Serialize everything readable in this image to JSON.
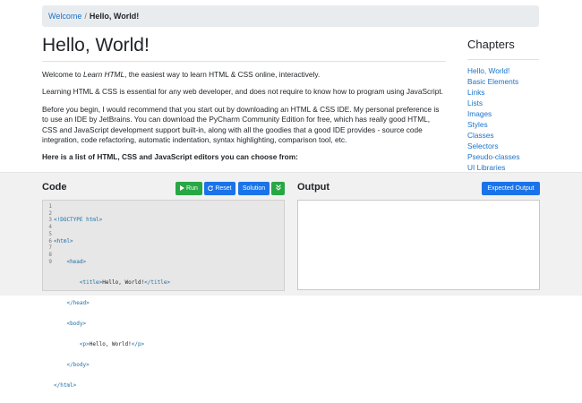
{
  "breadcrumb": {
    "home": "Welcome",
    "separator": "/",
    "current": "Hello, World!"
  },
  "page_title": "Hello, World!",
  "content": {
    "p1_prefix": "Welcome to ",
    "p1_em": "Learn HTML",
    "p1_suffix": ", the easiest way to learn HTML & CSS online, interactively.",
    "p2": "Learning HTML & CSS is essential for any web developer, and does not require to know how to program using JavaScript.",
    "p3": "Before you begin, I would recommend that you start out by downloading an HTML & CSS IDE. My personal preference is to use an IDE by JetBrains. You can download the PyCharm Community Edition for free, which has really good HTML, CSS and JavaScript development support built-in, along with all the goodies that a good IDE provides - source code integration, code refactoring, automatic indentation, syntax highlighting, comparison tool, etc.",
    "p4": "Here is a list of HTML, CSS and JavaScript editors you can choose from:"
  },
  "chapters": {
    "title": "Chapters",
    "items": [
      "Hello, World!",
      "Basic Elements",
      "Links",
      "Lists",
      "Images",
      "Styles",
      "Classes",
      "Selectors",
      "Pseudo-classes",
      "UI Libraries"
    ]
  },
  "code_pane": {
    "title": "Code",
    "run_label": "Run",
    "reset_label": "Reset",
    "solution_label": "Solution",
    "line_numbers": [
      "1",
      "2",
      "3",
      "4",
      "5",
      "6",
      "7",
      "8",
      "9"
    ],
    "lines": [
      "<!DOCTYPE html>",
      "<html>",
      "    <head>",
      "        <title>Hello, World!</title>",
      "    </head>",
      "    <body>",
      "        <p>Hello, World!</p>",
      "    </body>",
      "</html>"
    ]
  },
  "output_pane": {
    "title": "Output",
    "expected_label": "Expected Output"
  },
  "colors": {
    "link": "#1a73c9",
    "run": "#28a745",
    "primary": "#1a73e8",
    "tag": "#1d6fa5"
  }
}
